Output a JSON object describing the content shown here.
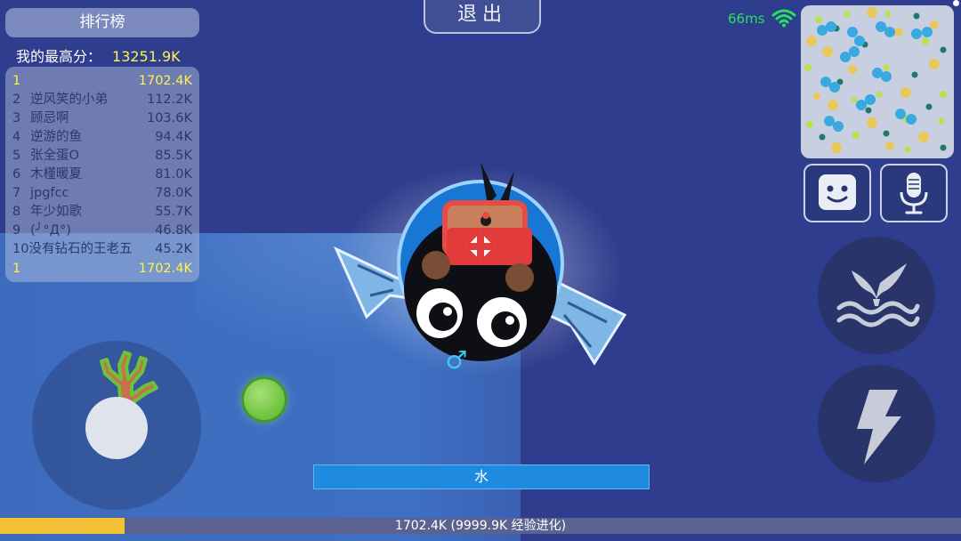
{
  "leaderboard": {
    "title": "排行榜",
    "best_label": "我的最高分：",
    "best_value": "13251.9K",
    "rows": [
      {
        "rank": "1",
        "name": "",
        "score": "1702.4K",
        "self": true
      },
      {
        "rank": "2",
        "name": "逆风笑的小弟",
        "score": "112.2K"
      },
      {
        "rank": "3",
        "name": "顾忌啊",
        "score": "103.6K"
      },
      {
        "rank": "4",
        "name": "逆游的鱼",
        "score": "94.4K"
      },
      {
        "rank": "5",
        "name": "张全蛋O",
        "score": "85.5K"
      },
      {
        "rank": "6",
        "name": "木槿暖夏",
        "score": "81.0K"
      },
      {
        "rank": "7",
        "name": "jpgfcc",
        "score": "78.0K"
      },
      {
        "rank": "8",
        "name": "年少如歌",
        "score": "55.7K"
      },
      {
        "rank": "9",
        "name": "(╯°Д°)",
        "score": "46.8K"
      },
      {
        "rank": "10",
        "name": "没有钻石的王老五",
        "score": "45.2K"
      }
    ],
    "my_row": {
      "rank": "1",
      "name": "",
      "score": "1702.4K"
    }
  },
  "exit_label": "退出",
  "network": {
    "ping": "66ms",
    "icon": "wifi-icon",
    "color": "#29e05c"
  },
  "buttons": {
    "emoji_icon": "emoji-icon",
    "voice_icon": "microphone-icon",
    "dive_icon": "whale-tail-icon",
    "boost_icon": "lightning-icon"
  },
  "player": {
    "gender_symbol": "♂"
  },
  "zone_label": "水",
  "xp": {
    "text": "1702.4K (9999.9K 经验进化)",
    "progress": 0.13,
    "color": "#f5c237"
  }
}
